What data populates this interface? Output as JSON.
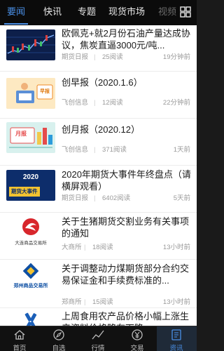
{
  "top_tabs": [
    "要闻",
    "快讯",
    "专题",
    "现货市场",
    "视频"
  ],
  "active_tab_index": 0,
  "news": [
    {
      "title": "欧佩克+就2月份石油产量达成协议，焦炭直逼3000元/吨...",
      "source": "期货日报",
      "reads": "25阅读",
      "time": "19分钟前",
      "thumb": "chart-thumbnail"
    },
    {
      "title": "创早报（2020.1.6）",
      "source": "飞创信息",
      "reads": "12阅读",
      "time": "22分钟前",
      "thumb": "morning-report-thumbnail",
      "thumb_label": "早报"
    },
    {
      "title": "创月报（2020.12）",
      "source": "飞创信息",
      "reads": "371阅读",
      "time": "1天前",
      "thumb": "monthly-report-thumbnail",
      "thumb_label": "月报"
    },
    {
      "title": "2020年期货大事件年终盘点（请横屏观看）",
      "source": "期货日报",
      "reads": "6402阅读",
      "time": "5天前",
      "thumb": "year-review-thumbnail",
      "thumb_year": "2020",
      "thumb_caption": "期货大事件"
    },
    {
      "title": "关于生猪期货交割业务有关事项的通知",
      "source": "大商所",
      "reads": "18阅读",
      "time": "13小时前",
      "thumb": "dce-logo-thumbnail",
      "thumb_label": "大连商品交易所"
    },
    {
      "title": "关于调整动力煤期货部分合约交易保证金和手续费标准的...",
      "source": "郑商所",
      "reads": "15阅读",
      "time": "13小时前",
      "thumb": "czce-logo-thumbnail",
      "thumb_label": "郑州商品交易所"
    },
    {
      "title": "上周食用农产品价格小幅上涨生产资料价格略有下降",
      "source": "",
      "reads": "",
      "time": "",
      "thumb": "shfe-logo-thumbnail"
    }
  ],
  "bottom_tabs": [
    {
      "label": "首页",
      "icon": "home-icon"
    },
    {
      "label": "自选",
      "icon": "compass-icon"
    },
    {
      "label": "行情",
      "icon": "trend-icon"
    },
    {
      "label": "交易",
      "icon": "yen-icon"
    },
    {
      "label": "资讯",
      "icon": "news-icon"
    }
  ],
  "active_bottom_index": 4,
  "colors": {
    "accent": "#4a8fe6",
    "topbar": "#0b0b0b",
    "bottombar": "#111111"
  }
}
